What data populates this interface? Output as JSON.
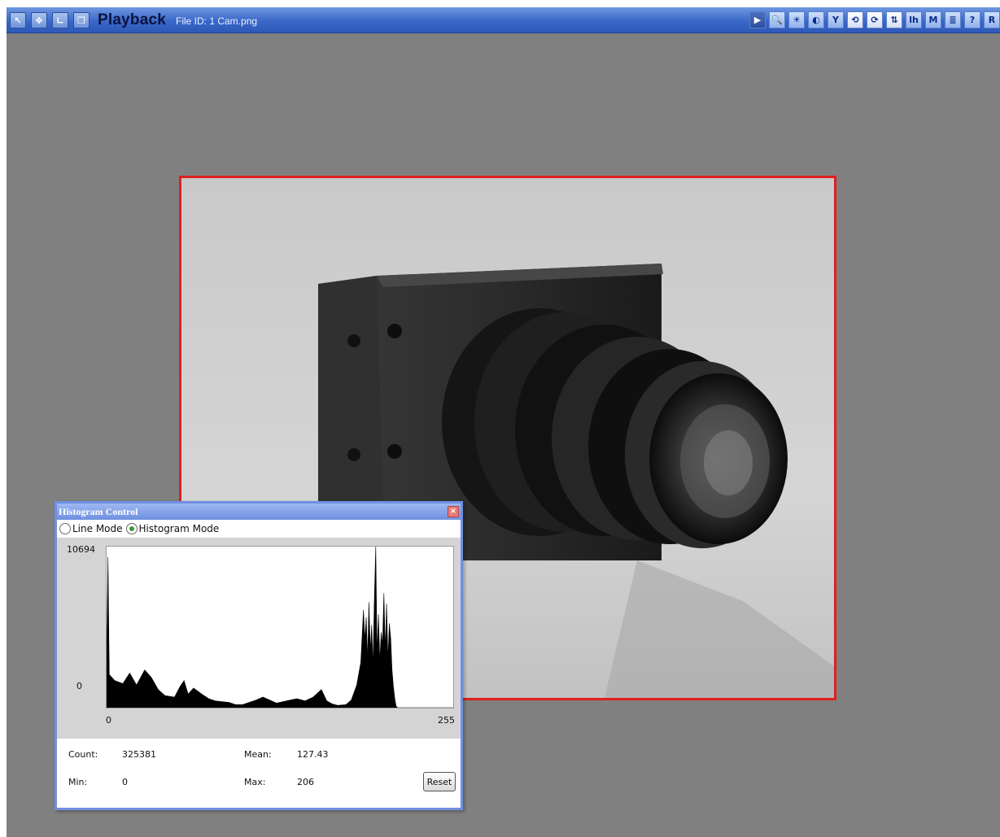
{
  "toolbar": {
    "title": "Playback",
    "file_id": "File ID: 1  Cam.png",
    "left_icons": [
      "select-arrow-icon",
      "move-crosshair-icon",
      "axes-icon",
      "window-icon"
    ],
    "right_icons": [
      {
        "name": "play-icon",
        "glyph": "▶"
      },
      {
        "name": "zoom-icon",
        "glyph": "🔍"
      },
      {
        "name": "brightness-icon",
        "glyph": "☀"
      },
      {
        "name": "contrast-icon",
        "glyph": "◐"
      },
      {
        "name": "filter-icon",
        "glyph": "Y"
      },
      {
        "name": "rotate-left-icon",
        "glyph": "⟲"
      },
      {
        "name": "rotate-right-icon",
        "glyph": "⟳"
      },
      {
        "name": "flip-icon",
        "glyph": "⇅"
      },
      {
        "name": "histogram-icon",
        "glyph": "lh"
      },
      {
        "name": "measure-icon",
        "glyph": "M"
      },
      {
        "name": "list-icon",
        "glyph": "≣"
      },
      {
        "name": "help-icon",
        "glyph": "?"
      },
      {
        "name": "record-icon",
        "glyph": "R"
      }
    ]
  },
  "histogram_dialog": {
    "title": "Histogram Control",
    "close_label": "×",
    "line_mode_label": "Line Mode",
    "histogram_mode_label": "Histogram Mode",
    "selected_mode": "Histogram Mode",
    "y_max_label": "10694",
    "y_min_label": "0",
    "x_min_label": "0",
    "x_max_label": "255",
    "count_label": "Count:",
    "count_value": "325381",
    "mean_label": "Mean:",
    "mean_value": "127.43",
    "min_label": "Min:",
    "min_value": "0",
    "max_label": "Max:",
    "max_value": "206",
    "reset_label": "Reset"
  },
  "chart_data": {
    "type": "area",
    "x_range": [
      0,
      255
    ],
    "y_range": [
      0,
      10694
    ],
    "profile": [
      [
        0,
        3500
      ],
      [
        1,
        10000
      ],
      [
        2,
        2200
      ],
      [
        6,
        1800
      ],
      [
        12,
        1600
      ],
      [
        17,
        2300
      ],
      [
        22,
        1500
      ],
      [
        28,
        2500
      ],
      [
        33,
        2000
      ],
      [
        38,
        1200
      ],
      [
        43,
        800
      ],
      [
        50,
        700
      ],
      [
        54,
        1400
      ],
      [
        57,
        1800
      ],
      [
        60,
        900
      ],
      [
        64,
        1300
      ],
      [
        70,
        900
      ],
      [
        75,
        600
      ],
      [
        80,
        450
      ],
      [
        90,
        350
      ],
      [
        95,
        200
      ],
      [
        100,
        200
      ],
      [
        110,
        500
      ],
      [
        115,
        700
      ],
      [
        120,
        500
      ],
      [
        125,
        300
      ],
      [
        135,
        500
      ],
      [
        140,
        600
      ],
      [
        146,
        450
      ],
      [
        152,
        700
      ],
      [
        158,
        1200
      ],
      [
        162,
        450
      ],
      [
        166,
        250
      ],
      [
        170,
        150
      ],
      [
        176,
        200
      ],
      [
        180,
        500
      ],
      [
        184,
        1500
      ],
      [
        187,
        3000
      ],
      [
        189,
        6500
      ],
      [
        190,
        4500
      ],
      [
        191,
        6000
      ],
      [
        192,
        3200
      ],
      [
        193,
        7000
      ],
      [
        194,
        3800
      ],
      [
        195,
        5500
      ],
      [
        196,
        2800
      ],
      [
        197,
        7200
      ],
      [
        198,
        10694
      ],
      [
        199,
        3600
      ],
      [
        200,
        6200
      ],
      [
        201,
        3100
      ],
      [
        202,
        5000
      ],
      [
        203,
        4200
      ],
      [
        204,
        7600
      ],
      [
        205,
        3800
      ],
      [
        206,
        6900
      ],
      [
        207,
        3200
      ],
      [
        208,
        5600
      ],
      [
        209,
        4600
      ],
      [
        210,
        2500
      ],
      [
        211,
        1400
      ],
      [
        212,
        600
      ],
      [
        213,
        100
      ],
      [
        214,
        0
      ],
      [
        255,
        0
      ]
    ]
  }
}
